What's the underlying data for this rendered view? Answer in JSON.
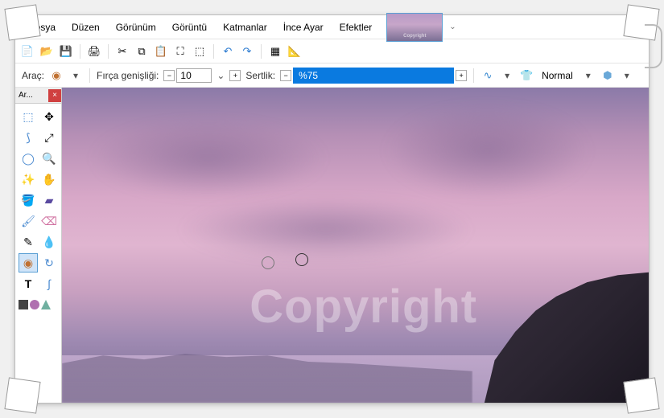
{
  "menu": {
    "file": "Dosya",
    "edit": "Düzen",
    "view": "Görünüm",
    "image": "Görüntü",
    "layers": "Katmanlar",
    "adjust": "İnce Ayar",
    "effects": "Efektler"
  },
  "thumbnail_label": "Copyright",
  "toolbar": {
    "new": "new-icon",
    "open": "open-icon",
    "save": "save-icon",
    "print": "print-icon",
    "cut": "cut-icon",
    "copy": "copy-icon",
    "paste": "paste-icon",
    "crop": "crop-icon",
    "deselect": "deselect-icon",
    "undo": "undo-icon",
    "redo": "redo-icon",
    "grid": "grid-icon",
    "ruler": "ruler-icon"
  },
  "options": {
    "tool_label": "Araç:",
    "brush_width_label": "Fırça genişliği:",
    "brush_width_value": "10",
    "hardness_label": "Sertlik:",
    "hardness_value": "%75",
    "blend_label": "Normal"
  },
  "toolbox": {
    "title": "Ar...",
    "tools": {
      "rect_select": "rectangle-select",
      "move": "move",
      "lasso": "lasso",
      "move_selection": "move-selection",
      "ellipse": "ellipse-select",
      "zoom": "zoom",
      "wand": "magic-wand",
      "pan": "pan",
      "bucket": "paint-bucket",
      "gradient": "gradient",
      "brush": "paintbrush",
      "eraser": "eraser",
      "pencil": "pencil",
      "eyedropper": "color-picker",
      "clone": "clone-stamp",
      "recolor": "recolor",
      "text": "text",
      "line": "line-curve"
    },
    "text_glyph": "T"
  },
  "canvas": {
    "watermark_text": "Copyright"
  }
}
